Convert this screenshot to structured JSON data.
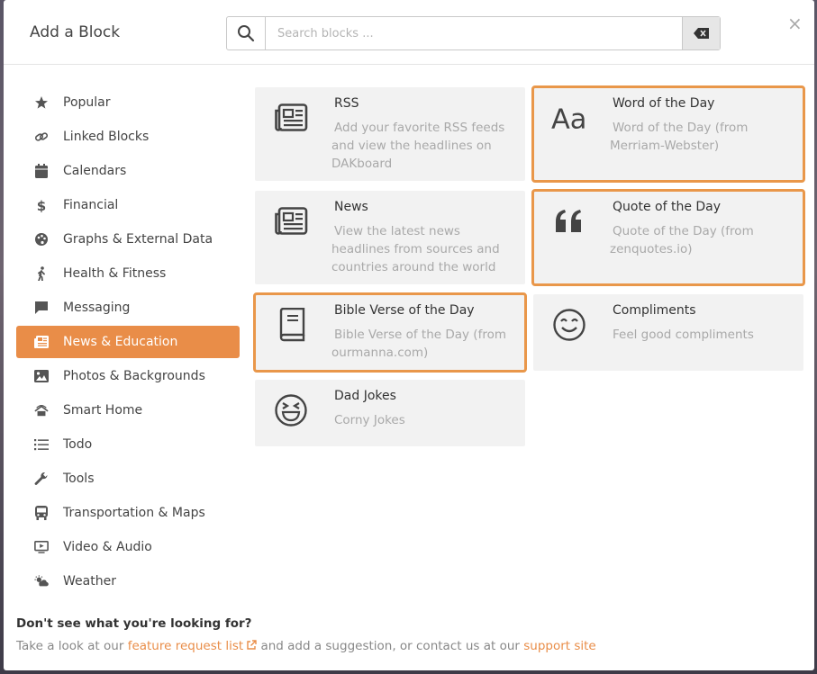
{
  "header": {
    "title": "Add a Block",
    "search_placeholder": "Search blocks ...",
    "close_label": "×"
  },
  "sidebar": {
    "items": [
      {
        "label": "Popular",
        "icon": "star-icon"
      },
      {
        "label": "Linked Blocks",
        "icon": "link-icon"
      },
      {
        "label": "Calendars",
        "icon": "calendar-icon"
      },
      {
        "label": "Financial",
        "icon": "dollar-icon"
      },
      {
        "label": "Graphs & External Data",
        "icon": "palette-icon"
      },
      {
        "label": "Health & Fitness",
        "icon": "walking-icon"
      },
      {
        "label": "Messaging",
        "icon": "message-icon"
      },
      {
        "label": "News & Education",
        "icon": "newspaper-icon",
        "active": true
      },
      {
        "label": "Photos & Backgrounds",
        "icon": "image-icon"
      },
      {
        "label": "Smart Home",
        "icon": "smart-home-icon"
      },
      {
        "label": "Todo",
        "icon": "list-icon"
      },
      {
        "label": "Tools",
        "icon": "wrench-icon"
      },
      {
        "label": "Transportation & Maps",
        "icon": "bus-icon"
      },
      {
        "label": "Video & Audio",
        "icon": "monitor-icon"
      },
      {
        "label": "Weather",
        "icon": "weather-icon"
      }
    ]
  },
  "cards": [
    {
      "title": "RSS",
      "desc": "Add your favorite RSS feeds and view the headlines on DAKboard",
      "icon": "newspaper-icon",
      "highlighted": false
    },
    {
      "title": "Word of the Day",
      "desc": "Word of the Day (from Merriam-Webster)",
      "icon": "font-aa-icon",
      "highlighted": true
    },
    {
      "title": "News",
      "desc": "View the latest news headlines from sources and countries around the world",
      "icon": "newspaper-icon",
      "highlighted": false
    },
    {
      "title": "Quote of the Day",
      "desc": "Quote of the Day (from zenquotes.io)",
      "icon": "quote-icon",
      "highlighted": true
    },
    {
      "title": "Bible Verse of the Day",
      "desc": "Bible Verse of the Day (from ourmanna.com)",
      "icon": "book-icon",
      "highlighted": true
    },
    {
      "title": "Compliments",
      "desc": "Feel good compliments",
      "icon": "smile-icon",
      "highlighted": false
    },
    {
      "title": "Dad Jokes",
      "desc": "Corny Jokes",
      "icon": "laugh-icon",
      "highlighted": false
    }
  ],
  "footer": {
    "question": "Don't see what you're looking for?",
    "text_1": "Take a look at our ",
    "link_1": "feature request list",
    "text_2": " and add a suggestion, or contact us at our ",
    "link_2": "support site"
  },
  "colors": {
    "accent": "#e98d48",
    "highlight_border": "#e9974a",
    "card_bg": "#f2f2f2"
  }
}
